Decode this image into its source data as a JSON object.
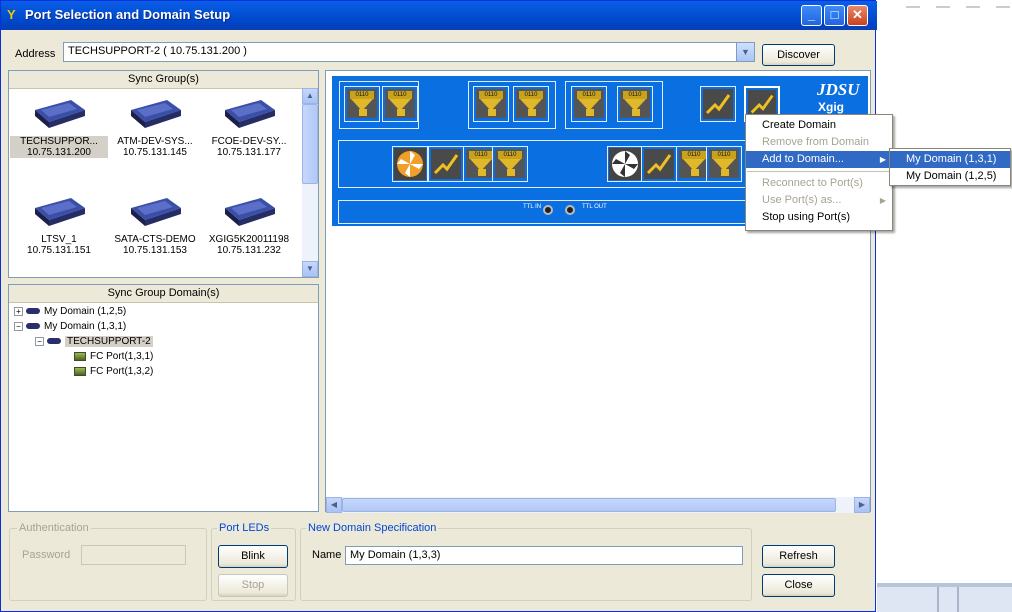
{
  "window": {
    "title": "Port Selection and Domain Setup"
  },
  "address": {
    "label": "Address",
    "value": "TECHSUPPORT-2 ( 10.75.131.200 )",
    "discover_label": "Discover"
  },
  "sync_groups": {
    "header": "Sync Group(s)",
    "devices": [
      {
        "name": "TECHSUPPOR...",
        "ip": "10.75.131.200"
      },
      {
        "name": "ATM-DEV-SYS...",
        "ip": "10.75.131.145"
      },
      {
        "name": "FCOE-DEV-SY...",
        "ip": "10.75.131.177"
      },
      {
        "name": "LTSV_1",
        "ip": "10.75.131.151"
      },
      {
        "name": "SATA-CTS-DEMO",
        "ip": "10.75.131.153"
      },
      {
        "name": "XGIG5K20011198",
        "ip": "10.75.131.232"
      }
    ]
  },
  "domains": {
    "header": "Sync Group Domain(s)",
    "tree": [
      {
        "label": "My Domain (1,2,5)"
      },
      {
        "label": "My Domain (1,3,1)"
      },
      {
        "label": "TECHSUPPORT-2"
      },
      {
        "label": "FC Port(1,3,1)"
      },
      {
        "label": "FC Port(1,3,2)"
      }
    ]
  },
  "chassis": {
    "brand": "JDSU",
    "model": "Xgig",
    "ttl_in": "TTL IN",
    "ttl_out": "TTL OUT"
  },
  "context_menu": {
    "items": [
      {
        "label": "Create Domain",
        "enabled": true
      },
      {
        "label": "Remove from Domain",
        "enabled": false
      },
      {
        "label": "Add to Domain...",
        "enabled": true,
        "highlighted": true
      },
      {
        "label": "Reconnect to Port(s)",
        "enabled": false
      },
      {
        "label": "Use Port(s) as...",
        "enabled": false
      },
      {
        "label": "Stop using Port(s)",
        "enabled": true
      }
    ],
    "submenu": [
      {
        "label": "My Domain (1,3,1)",
        "highlighted": true
      },
      {
        "label": "My Domain (1,2,5)"
      }
    ]
  },
  "authentication": {
    "group_label": "Authentication",
    "password_label": "Password"
  },
  "port_leds": {
    "group_label": "Port LEDs",
    "blink_label": "Blink",
    "stop_label": "Stop"
  },
  "new_domain": {
    "group_label": "New Domain Specification",
    "name_label": "Name",
    "name_value": "My Domain (1,3,3)"
  },
  "buttons": {
    "refresh_label": "Refresh",
    "close_label": "Close"
  },
  "colors": {
    "title_bar": "#0054e3",
    "panel_blue": "#0a6fe0",
    "menu_highlight": "#316ac5",
    "window_bg": "#ece9d8"
  }
}
